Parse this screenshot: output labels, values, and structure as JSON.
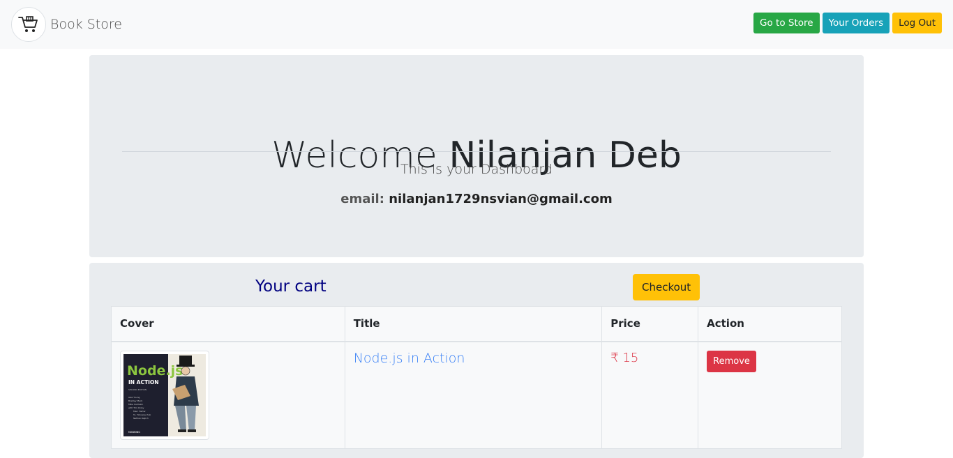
{
  "navbar": {
    "brand_name": "Book Store",
    "logo_icon": "shopping-cart-icon",
    "buttons": {
      "go_to_store": "Go to Store",
      "your_orders": "Your Orders",
      "log_out": "Log Out"
    }
  },
  "jumbotron": {
    "welcome_prefix": "Welcome ",
    "user_name": "Nilanjan Deb",
    "subtitle": "This is your Dashboard",
    "email_label": "email:",
    "email_value": "nilanjan1729nsvian@gmail.com"
  },
  "cart": {
    "title": "Your cart",
    "checkout_label": "Checkout",
    "columns": [
      "Cover",
      "Title",
      "Price",
      "Action"
    ],
    "items": [
      {
        "cover_title_main": "Node.js",
        "cover_title_sub": "IN ACTION",
        "cover_edition": "SECOND EDITION",
        "cover_authors": [
          "Alex Young",
          "Bradley Meck",
          "Mike Cantelon",
          "with Tim Oxley",
          "Marc Harter",
          "T.J. Holowaychuk",
          "Nathan Rajlich"
        ],
        "cover_publisher": "MANNING",
        "title": "Node.js in Action",
        "price": "₹ 15",
        "action_label": "Remove"
      }
    ]
  },
  "colors": {
    "navbar_bg": "#f8f9fa",
    "panel_bg": "#e9ecef",
    "success": "#28a745",
    "info": "#17a2b8",
    "warning": "#ffc107",
    "danger": "#dc3545",
    "cart_title": "#000080",
    "link": "#3b82f6"
  }
}
